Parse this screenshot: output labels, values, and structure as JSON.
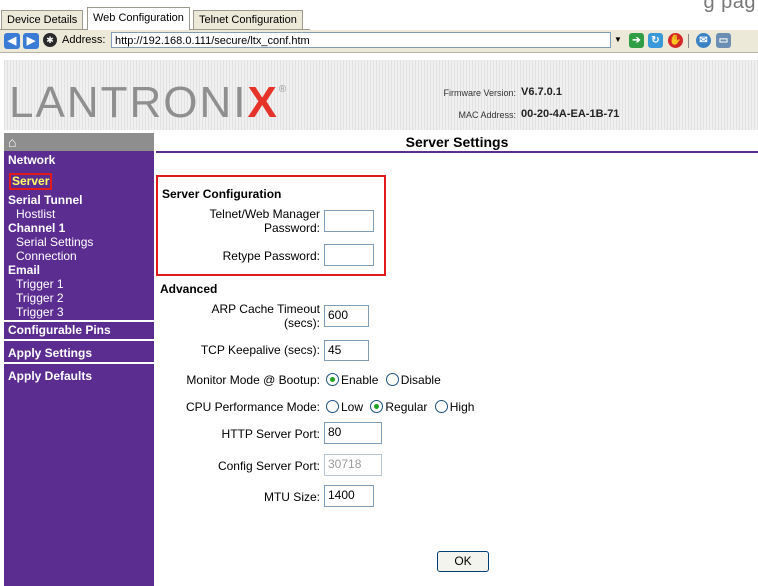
{
  "tabs": {
    "items": [
      {
        "label": "Device Details"
      },
      {
        "label": "Web Configuration"
      },
      {
        "label": "Telnet Configuration"
      }
    ],
    "active_index": 1,
    "corner_text": "g pag"
  },
  "addressbar": {
    "label": "Address:",
    "url": "http://192.168.0.111/secure/ltx_conf.htm"
  },
  "header": {
    "logo_text": "LANTRONI",
    "logo_x": "X",
    "logo_reg": "®",
    "firmware_label": "Firmware Version:",
    "firmware_value": "V6.7.0.1",
    "mac_label": "MAC Address:",
    "mac_value": "00-20-4A-EA-1B-71"
  },
  "sidebar": {
    "home_icon": "⌂",
    "items": [
      {
        "label": "Network"
      },
      {
        "label": "Server"
      },
      {
        "label": "Serial Tunnel"
      },
      {
        "label": "Hostlist"
      },
      {
        "label": "Channel 1"
      },
      {
        "label": "Serial Settings"
      },
      {
        "label": "Connection"
      },
      {
        "label": "Email"
      },
      {
        "label": "Trigger 1"
      },
      {
        "label": "Trigger 2"
      },
      {
        "label": "Trigger 3"
      },
      {
        "label": "Configurable Pins"
      },
      {
        "label": "Apply Settings"
      },
      {
        "label": "Apply Defaults"
      }
    ],
    "selected": "Server"
  },
  "main": {
    "title": "Server Settings",
    "server_config": {
      "heading": "Server Configuration",
      "password_label_1": "Telnet/Web Manager",
      "password_label_2": "Password:",
      "password_value": "",
      "retype_label": "Retype Password:",
      "retype_value": ""
    },
    "advanced": {
      "heading": "Advanced",
      "arp_label_1": "ARP Cache Timeout",
      "arp_label_2": "(secs):",
      "arp_value": "600",
      "tcp_label": "TCP Keepalive (secs):",
      "tcp_value": "45",
      "monitor_label": "Monitor Mode @ Bootup:",
      "monitor_options": [
        "Enable",
        "Disable"
      ],
      "monitor_selected": "Enable",
      "cpu_label": "CPU Performance Mode:",
      "cpu_options": [
        "Low",
        "Regular",
        "High"
      ],
      "cpu_selected": "Regular",
      "http_label": "HTTP Server Port:",
      "http_value": "80",
      "config_label": "Config Server Port:",
      "config_value": "30718",
      "mtu_label": "MTU Size:",
      "mtu_value": "1400"
    },
    "ok_label": "OK"
  }
}
